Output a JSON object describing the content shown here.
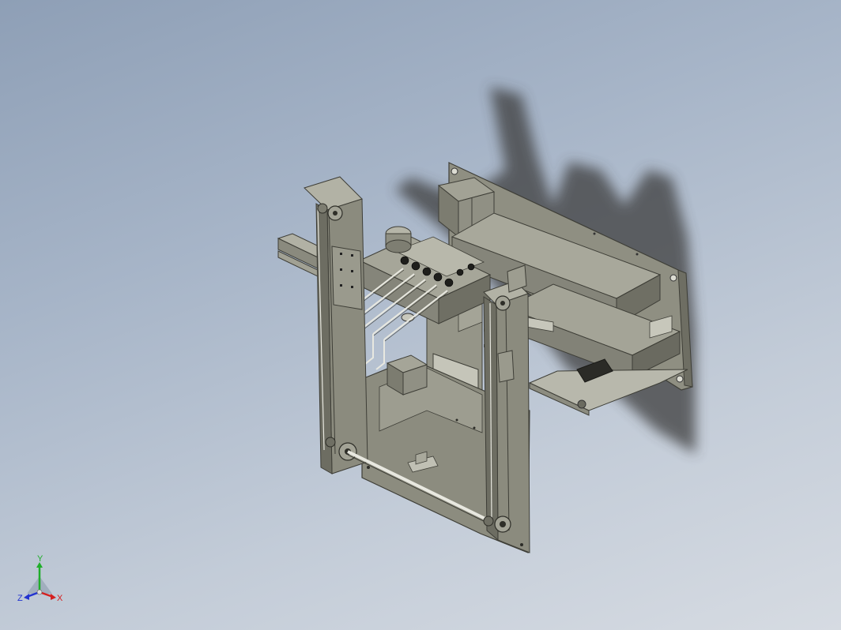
{
  "viewport": {
    "background_top": "#8e9fb6",
    "background_bottom": "#d6dbe2",
    "model_color": "#8a8a7c",
    "model_dark": "#55554c",
    "model_light": "#b3b3a6",
    "shadow_color": "#3d3d3d"
  },
  "triad": {
    "x_label": "X",
    "y_label": "Y",
    "z_label": "Z",
    "x_color": "#d42020",
    "y_color": "#1fae2a",
    "z_color": "#2233d0"
  }
}
